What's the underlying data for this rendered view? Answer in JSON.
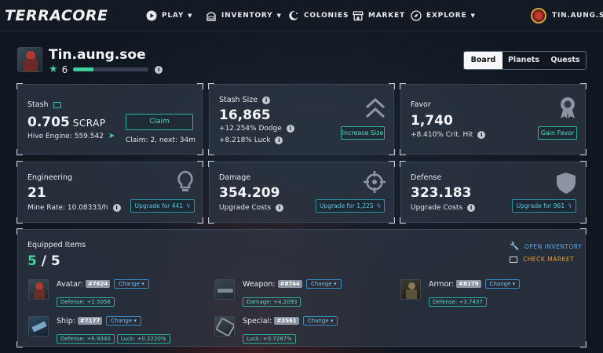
{
  "nav": {
    "logo": "TERRACORE",
    "play": "PLAY",
    "inventory": "INVENTORY",
    "colonies": "COLONIES",
    "market": "MARKET",
    "explore": "EXPLORE",
    "user": "TIN.AUNG.SOE"
  },
  "profile": {
    "name": "Tin.aung.soe",
    "level": "6",
    "xp_fraction": 0.27
  },
  "tabs": [
    "Board",
    "Planets",
    "Quests"
  ],
  "stash": {
    "label": "Stash",
    "value": "0.705",
    "unit": "SCRAP",
    "hive_engine": "Hive Engine: 559.542",
    "claim_button": "Claim",
    "claim_info": "Claim: 2, next: 34m"
  },
  "stash_size": {
    "label": "Stash Size",
    "value": "16,865",
    "dodge": "+12.254% Dodge",
    "luck": "+8.218% Luck",
    "button": "Increase Size"
  },
  "favor": {
    "label": "Favor",
    "value": "1,740",
    "crit": "+8.410% Crit. Hit",
    "button": "Gain Favor"
  },
  "engineering": {
    "label": "Engineering",
    "value": "21",
    "rate": "Mine Rate: 10.08333/h",
    "button": "Upgrade for 441"
  },
  "damage": {
    "label": "Damage",
    "value": "354.209",
    "costs": "Upgrade Costs",
    "button": "Upgrade for 1,225"
  },
  "defense": {
    "label": "Defense",
    "value": "323.183",
    "costs": "Upgrade Costs",
    "button": "Upgrade for 961"
  },
  "equipped": {
    "title": "Equipped Items",
    "count": "5",
    "total": "5",
    "open_inventory": "OPEN INVENTORY",
    "check_market": "CHECK MARKET",
    "change": "Change",
    "items": [
      {
        "slot": "Avatar:",
        "id": "#7624",
        "stats": [
          "Defense: +2.5056"
        ]
      },
      {
        "slot": "Weapon:",
        "id": "#8744",
        "stats": [
          "Damage: +4.2093"
        ]
      },
      {
        "slot": "Armor:",
        "id": "#8179",
        "stats": [
          "Defense: +3.7437"
        ]
      },
      {
        "slot": "Ship:",
        "id": "#7177",
        "stats": [
          "Defense: +6.9340",
          "Luck: +0.2220%"
        ]
      },
      {
        "slot": "Special:",
        "id": "#2561",
        "stats": [
          "Luck: +0.7287%"
        ]
      }
    ]
  },
  "colors": {
    "accent_green": "#44d39b",
    "accent_teal": "#2fb3a1",
    "accent_blue": "#3a88c2",
    "check_market": "#e0a23a"
  },
  "icons": [
    "play-icon",
    "inventory-icon",
    "colonies-icon",
    "market-icon",
    "explore-icon",
    "star-icon",
    "info-icon",
    "chevrons-up-icon",
    "medal-icon",
    "lightbulb-icon",
    "crosshair-icon",
    "shield-icon",
    "wrench-icon",
    "market-sign-icon",
    "bolt-icon"
  ]
}
